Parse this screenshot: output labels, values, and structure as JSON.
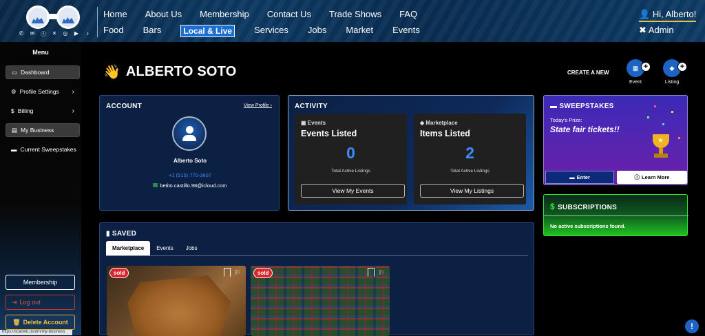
{
  "nav": {
    "row1": [
      "Home",
      "About Us",
      "Membership",
      "Contact Us",
      "Trade Shows",
      "FAQ"
    ],
    "row2": [
      "Food",
      "Bars",
      "Local & Live",
      "Services",
      "Jobs",
      "Market",
      "Events"
    ],
    "greeting": "Hi, Alberto!",
    "admin": "Admin"
  },
  "social_icons": [
    "phone-icon",
    "email-icon",
    "facebook-icon",
    "x-icon",
    "instagram-icon",
    "youtube-icon",
    "tiktok-icon"
  ],
  "sidebar": {
    "title": "Menu",
    "items": [
      {
        "label": "Dashboard",
        "icon": "laptop-icon",
        "selected": true
      },
      {
        "label": "Profile Settings",
        "icon": "gear-icon",
        "chevron": true
      },
      {
        "label": "Billing",
        "icon": "dollar-icon",
        "chevron": true
      },
      {
        "label": "My Business",
        "icon": "store-icon",
        "selected": true
      },
      {
        "label": "Current Sweepstakes",
        "icon": "ticket-icon"
      }
    ],
    "membership": "Membership",
    "logout": "Log out",
    "delete": "Delete Account",
    "status_url": "https://scanwit.us/dm/my-business"
  },
  "page": {
    "title": "ALBERTO SOTO",
    "create_new": "CREATE A NEW",
    "create_event": "Event",
    "create_listing": "Listing"
  },
  "account": {
    "heading": "ACCOUNT",
    "view_profile": "View Profile",
    "name": "Alberto Soto",
    "phone": "+1 (515) 770-3607",
    "email": "betito.castillo.98@icloud.com"
  },
  "activity": {
    "heading": "ACTIVITY",
    "events": {
      "tag": "Events",
      "title": "Events Listed",
      "count": "0",
      "caption": "Total Active Listings",
      "button": "View My Events"
    },
    "market": {
      "tag": "Marketplace",
      "title": "Items Listed",
      "count": "2",
      "caption": "Total Active Listings",
      "button": "View My Listings"
    }
  },
  "sweepstakes": {
    "heading": "SWEEPSTAKES",
    "todays_prize_label": "Today's Prize:",
    "prize": "State fair tickets!!",
    "enter": "Enter",
    "learn_more": "Learn More"
  },
  "subscriptions": {
    "heading": "SUBSCRIPTIONS",
    "message": "No active subscriptions found."
  },
  "saved": {
    "heading": "SAVED",
    "tabs": [
      "Marketplace",
      "Events",
      "Jobs"
    ],
    "active_tab": "Marketplace",
    "items": [
      {
        "badge": "sold"
      },
      {
        "badge": "sold"
      }
    ]
  },
  "colors": {
    "accent": "#1c63c4",
    "sold": "#d8262c",
    "count": "#3d8bff",
    "greeting_underline": "#e8c24a"
  }
}
